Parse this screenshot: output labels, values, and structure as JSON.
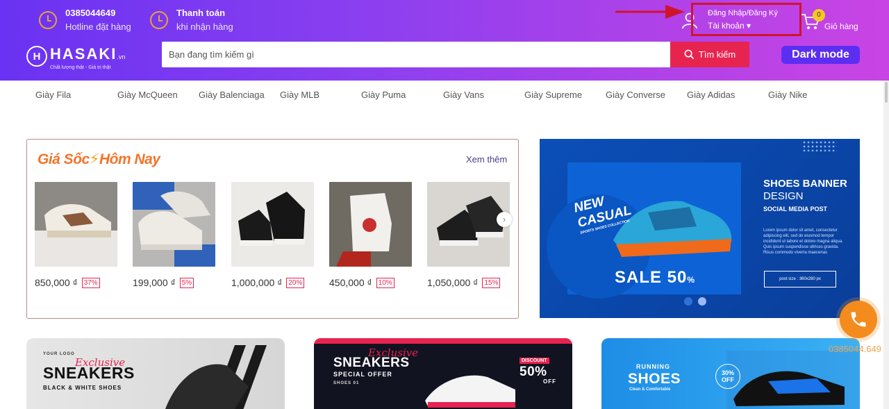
{
  "header": {
    "hotline": {
      "value": "0385044649",
      "label": "Hotline đặt hàng"
    },
    "payment": {
      "title": "Thanh toán",
      "subtitle": "khi nhận hàng"
    },
    "logo": {
      "name": "HASAKI",
      "suffix": ".vn",
      "slogan": "Chất lượng thật - Giá trị thật",
      "mark": "H"
    },
    "search": {
      "placeholder": "Bạn đang tìm kiếm gì",
      "button_label": "Tìm kiếm"
    },
    "account": {
      "top_label": "Đăng Nhập/Đăng Ký",
      "bottom_label": "Tài khoản"
    },
    "cart": {
      "count": "0",
      "label": "Giỏ hàng"
    },
    "dark_mode_label": "Dark mode",
    "highlight_color": "#d0132c"
  },
  "nav": {
    "items": [
      "Giày Fila",
      "Giày McQueen",
      "Giày Balenciaga",
      "Giày MLB",
      "Giày Puma",
      "Giày Vans",
      "Giày Supreme",
      "Giày Converse",
      "Giày Adidas",
      "Giày Nike"
    ]
  },
  "flash_sale": {
    "title_part1": "Giá Sốc",
    "title_part2": "Hôm Nay",
    "see_more": "Xem thêm",
    "products": [
      {
        "price": "850,000 ₫",
        "discount": "37%"
      },
      {
        "price": "199,000 ₫",
        "discount": "5%"
      },
      {
        "price": "1,000,000 ₫",
        "discount": "20%"
      },
      {
        "price": "450,000 ₫",
        "discount": "10%"
      },
      {
        "price": "1,050,000 ₫",
        "discount": "15%"
      }
    ]
  },
  "main_banner": {
    "badge_new": "NEW",
    "badge_casual": "CASUAL",
    "tagline": "SPORTS SHOES COLLECTION",
    "sale": "SALE 50",
    "sale_unit": "%",
    "heading": "SHOES BANNER",
    "heading2": "DESIGN",
    "subheading": "SOCIAL MEDIA POST",
    "lorem": "Lorem ipsum dolor sit amet, consectetur adipiscing elit, sed do eiusmod tempor incididunt ut labore et dolore magna aliqua. Quis ipsum suspendisse ultrices gravida. Risus commodo viverra maecenas",
    "post_size": "post size : 360x280 px"
  },
  "bottom_banners": [
    {
      "logo": "YOUR LOGO",
      "script": "Exclusive",
      "title": "SNEAKERS",
      "subtitle": "BLACK & WHITE SHOES"
    },
    {
      "script": "Exclusive",
      "title": "SNEAKERS",
      "subtitle": "SPECIAL OFFER",
      "tag": "SHOES 01",
      "discount_label": "DISCOUNT",
      "discount_value": "50%",
      "discount_off": "OFF"
    },
    {
      "title_small": "RUNNING",
      "title": "SHOES",
      "subtitle": "Clean & Comfortable",
      "discount_value": "30%",
      "discount_off": "OFF"
    }
  ],
  "float_phone": {
    "number": "0385044.649"
  }
}
